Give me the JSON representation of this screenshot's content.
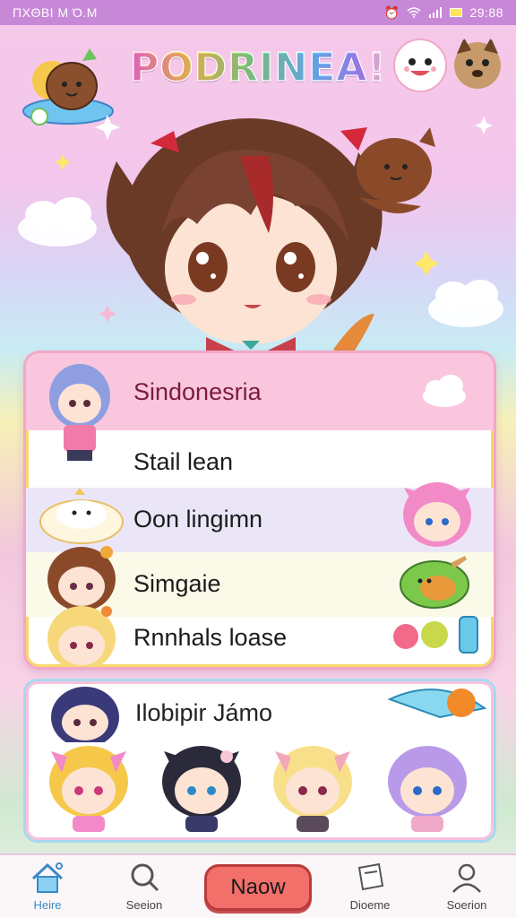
{
  "status_bar": {
    "left_text": "ΠΧΘΒΙ Μ Ό.Μ",
    "time": "29:88"
  },
  "header": {
    "logo_text": "PODRINEA!"
  },
  "list": {
    "items": [
      {
        "label": "Sindonesria"
      },
      {
        "label": "Stail lean"
      },
      {
        "label": "Oon lingimn"
      },
      {
        "label": "Simgaie"
      },
      {
        "label": "Rnnhals loase"
      }
    ]
  },
  "grid_card": {
    "title": "Ilobipir Jámo"
  },
  "bottom_nav": {
    "items": [
      {
        "label": "Heire",
        "icon": "home-icon"
      },
      {
        "label": "Seeion",
        "icon": "search-icon"
      },
      {
        "label": "Naow",
        "icon": "new-button"
      },
      {
        "label": "Dioeme",
        "icon": "document-icon"
      },
      {
        "label": "Soerion",
        "icon": "profile-icon"
      }
    ],
    "active_index": 0
  },
  "colors": {
    "status_bar": "#c888d8",
    "accent_pink": "#f2a8c8",
    "new_button": "#f26f6a",
    "active_nav": "#3a8ac8"
  }
}
